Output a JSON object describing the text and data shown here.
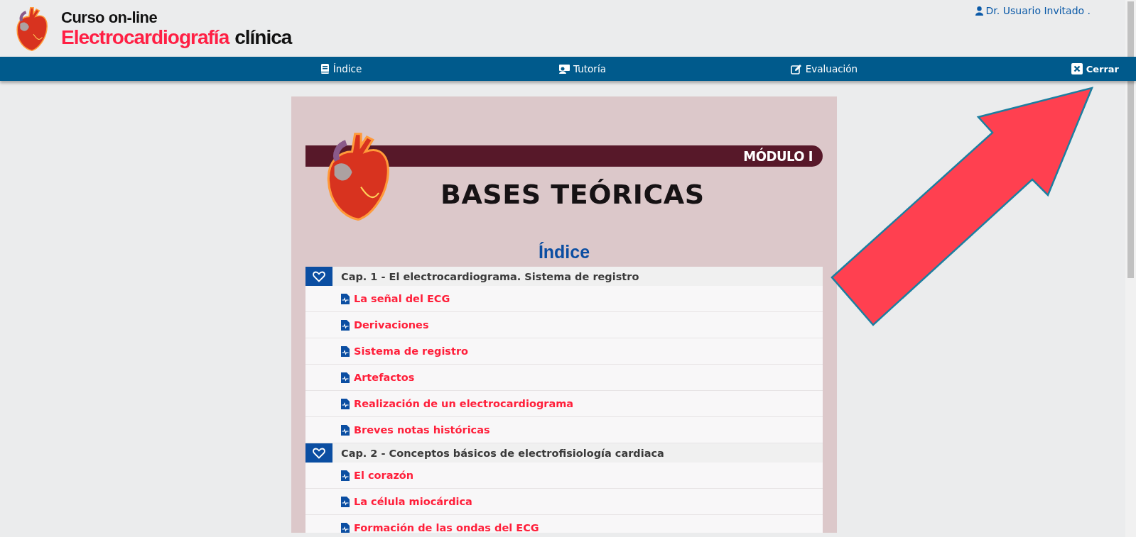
{
  "header": {
    "logo_line1": "Curso on-line",
    "logo_title": "Electrocardiografía",
    "logo_subtitle": "clínica",
    "user": "Dr. Usuario Invitado ."
  },
  "nav": [
    {
      "label": "Índice",
      "kind": "book"
    },
    {
      "label": "Tutoría",
      "kind": "teacher"
    },
    {
      "label": "Evaluación",
      "kind": "edit"
    },
    {
      "label": "Cerrar",
      "kind": "close"
    }
  ],
  "module": {
    "badge": "MÓDULO I",
    "title": "BASES TEÓRICAS"
  },
  "index": {
    "title": "Índice",
    "chapters": [
      {
        "title": "Cap. 1 - El electrocardiograma. Sistema de registro",
        "items": [
          "La señal del ECG",
          "Derivaciones",
          "Sistema de registro",
          "Artefactos",
          "Realización de un electrocardiograma",
          "Breves notas históricas"
        ]
      },
      {
        "title": "Cap. 2 - Conceptos básicos de electrofisiología cardiaca",
        "items": [
          "El corazón",
          "La célula miocárdica",
          "Formación de las ondas del ECG"
        ]
      }
    ]
  }
}
